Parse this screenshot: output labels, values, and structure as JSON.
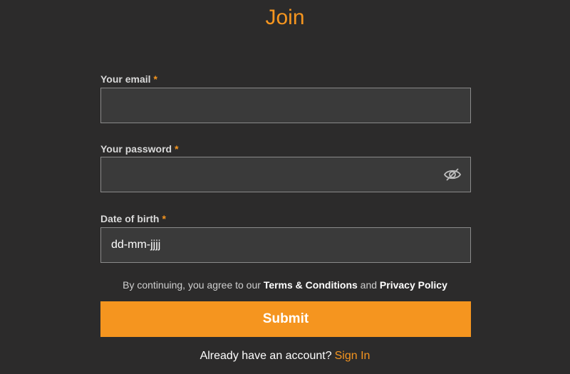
{
  "page": {
    "title": "Join"
  },
  "form": {
    "email": {
      "label": "Your email",
      "required_marker": "*",
      "value": ""
    },
    "password": {
      "label": "Your password",
      "required_marker": "*",
      "value": "",
      "toggle_icon": "eye-slash-icon"
    },
    "dob": {
      "label": "Date of birth",
      "required_marker": "*",
      "placeholder": "dd-mm-jjjj"
    }
  },
  "terms": {
    "prefix": "By continuing, you agree to our",
    "terms_link": "Terms & Conditions",
    "conjunction": "and",
    "privacy_link": "Privacy Policy"
  },
  "submit_label": "Submit",
  "signin": {
    "prompt": "Already have an account?",
    "link": "Sign In"
  },
  "colors": {
    "background": "#2c2b2b",
    "accent": "#f5951f",
    "field_bg": "#3a3a3a",
    "field_border": "#8a8a8a"
  }
}
